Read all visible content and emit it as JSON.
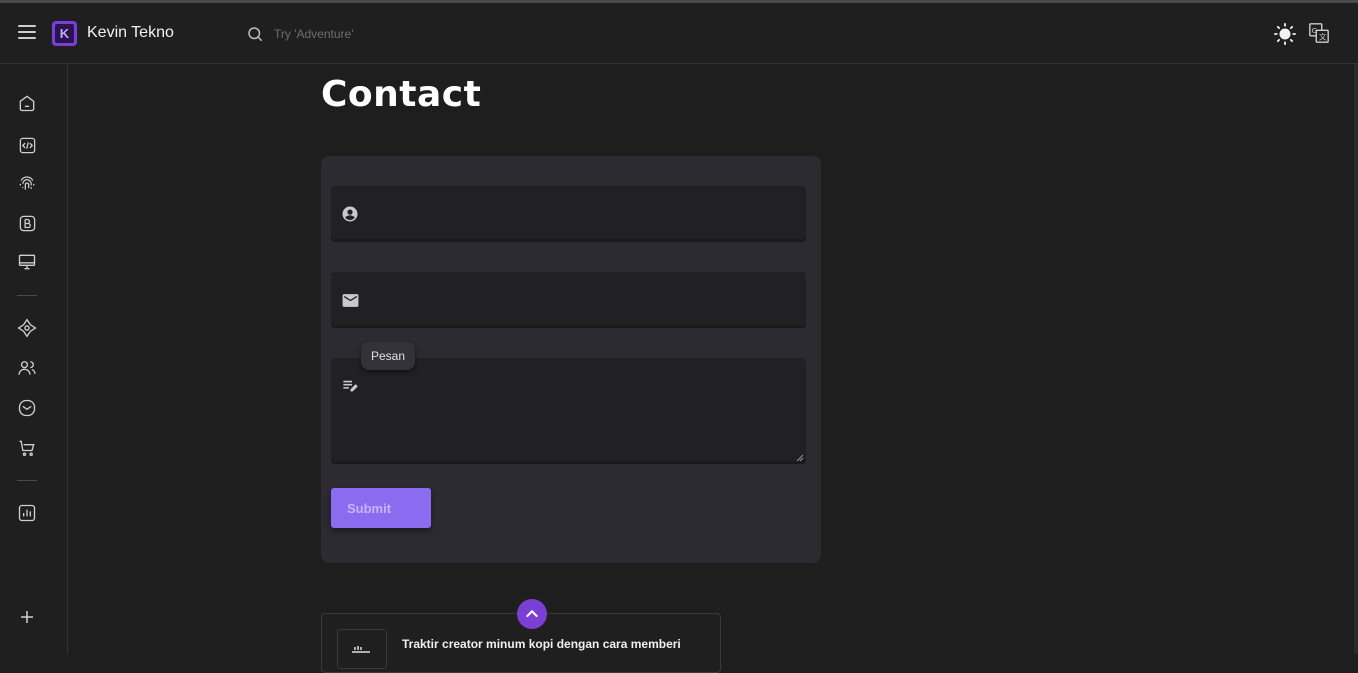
{
  "header": {
    "brand_letter": "K",
    "brand_name": "Kevin Tekno",
    "search_placeholder": "Try 'Adventure'"
  },
  "icons": {
    "menu": "hamburger-menu-icon",
    "search": "search-icon",
    "theme": "sun-icon",
    "language": "translate-icon"
  },
  "sidebar": {
    "items": [
      {
        "name": "home",
        "icon": "home-icon"
      },
      {
        "name": "code",
        "icon": "code-icon"
      },
      {
        "name": "fingerprint",
        "icon": "fingerprint-icon"
      },
      {
        "name": "blog",
        "icon": "blog-icon"
      },
      {
        "name": "desktop",
        "icon": "desktop-icon"
      },
      {
        "name": "explore",
        "icon": "compass-icon"
      },
      {
        "name": "users",
        "icon": "users-icon"
      },
      {
        "name": "contact",
        "icon": "mail-icon"
      },
      {
        "name": "shop",
        "icon": "cart-icon"
      },
      {
        "name": "stats",
        "icon": "chart-icon"
      },
      {
        "name": "add",
        "icon": "plus-icon"
      }
    ]
  },
  "main": {
    "title": "Contact",
    "form": {
      "name_value": "",
      "email_value": "",
      "message_value": "",
      "message_tooltip": "Pesan",
      "submit_label": "Submit"
    },
    "donate": {
      "text": "Traktir creator minum kopi dengan cara memberi"
    }
  },
  "colors": {
    "accent": "#7b3fd6",
    "submit": "#8b6cf0",
    "background": "#1e1e1f",
    "card": "#2c2b31"
  }
}
